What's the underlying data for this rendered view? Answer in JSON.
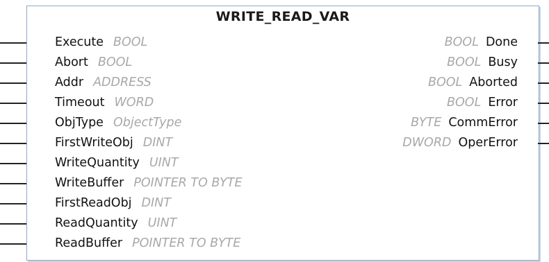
{
  "block": {
    "title": "WRITE_READ_VAR",
    "inputs": [
      {
        "name": "Execute",
        "type": "BOOL"
      },
      {
        "name": "Abort",
        "type": "BOOL"
      },
      {
        "name": "Addr",
        "type": "ADDRESS"
      },
      {
        "name": "Timeout",
        "type": "WORD"
      },
      {
        "name": "ObjType",
        "type": "ObjectType"
      },
      {
        "name": "FirstWriteObj",
        "type": "DINT"
      },
      {
        "name": "WriteQuantity",
        "type": "UINT"
      },
      {
        "name": "WriteBuffer",
        "type": "POINTER TO BYTE"
      },
      {
        "name": "FirstReadObj",
        "type": "DINT"
      },
      {
        "name": "ReadQuantity",
        "type": "UINT"
      },
      {
        "name": "ReadBuffer",
        "type": "POINTER TO BYTE"
      }
    ],
    "outputs": [
      {
        "name": "Done",
        "type": "BOOL"
      },
      {
        "name": "Busy",
        "type": "BOOL"
      },
      {
        "name": "Aborted",
        "type": "BOOL"
      },
      {
        "name": "Error",
        "type": "BOOL"
      },
      {
        "name": "CommError",
        "type": "BYTE"
      },
      {
        "name": "OperError",
        "type": "DWORD"
      }
    ],
    "colors": {
      "border": "#8ea8c4",
      "type_text": "#a8a8a8",
      "wire": "#222222"
    }
  }
}
